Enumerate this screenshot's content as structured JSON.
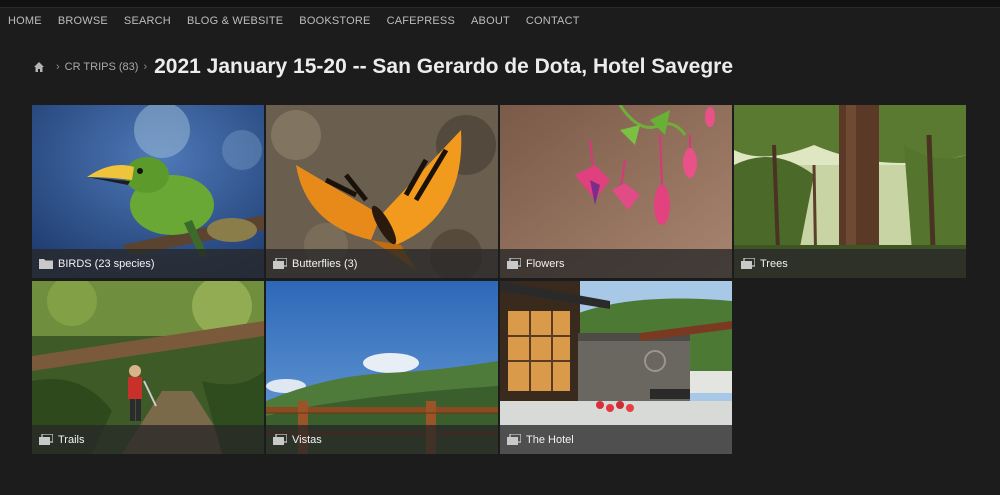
{
  "nav": {
    "items": [
      "HOME",
      "BROWSE",
      "SEARCH",
      "BLOG & WEBSITE",
      "BOOKSTORE",
      "CAFEPRESS",
      "ABOUT",
      "CONTACT"
    ]
  },
  "breadcrumb": {
    "home_icon": "home-icon",
    "parent": "CR TRIPS (83)",
    "title": "2021 January 15-20 -- San Gerardo de Dota, Hotel Savegre"
  },
  "galleries": [
    {
      "label": "BIRDS (23 species)",
      "icon": "folder-icon"
    },
    {
      "label": "Butterflies (3)",
      "icon": "gallery-icon"
    },
    {
      "label": "Flowers",
      "icon": "gallery-icon"
    },
    {
      "label": "Trees",
      "icon": "gallery-icon"
    },
    {
      "label": "Trails",
      "icon": "gallery-icon"
    },
    {
      "label": "Vistas",
      "icon": "gallery-icon"
    },
    {
      "label": "The Hotel",
      "icon": "gallery-icon"
    }
  ]
}
